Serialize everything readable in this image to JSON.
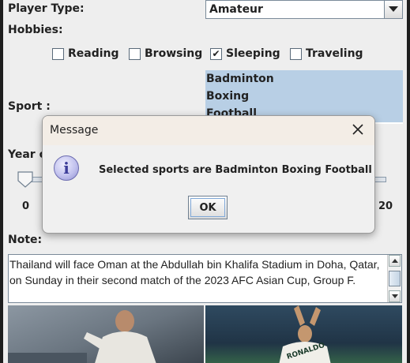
{
  "form": {
    "player_type_label": "Player Type:",
    "player_type_value": "Amateur",
    "hobbies_label": "Hobbies:",
    "hobbies": [
      {
        "label": "Reading",
        "checked": false
      },
      {
        "label": "Browsing",
        "checked": false
      },
      {
        "label": "Sleeping",
        "checked": true
      },
      {
        "label": "Traveling",
        "checked": false
      }
    ],
    "checkmark": "✔",
    "sport_label": "Sport :",
    "sports": [
      "Badminton",
      "Boxing",
      "Football"
    ],
    "year_label": "Year o",
    "slider": {
      "min_label": "0",
      "max_label": "20",
      "value": 0
    },
    "note_label": "Note:",
    "note_text": "Thailand will face Oman at the Abdullah bin Khalifa Stadium in Doha, Qatar, on Sunday in their second match of the 2023 AFC Asian Cup, Group F.",
    "photo_jersey_text": "RONALDO"
  },
  "dialog": {
    "title": "Message",
    "icon": "info-icon",
    "icon_glyph": "i",
    "message": "Selected sports are Badminton Boxing Football",
    "ok_label": "OK"
  },
  "colors": {
    "window_bg": "#eeeeee",
    "selection": "#b8cfe5",
    "dialog_title_bg": "#f3ede6"
  }
}
